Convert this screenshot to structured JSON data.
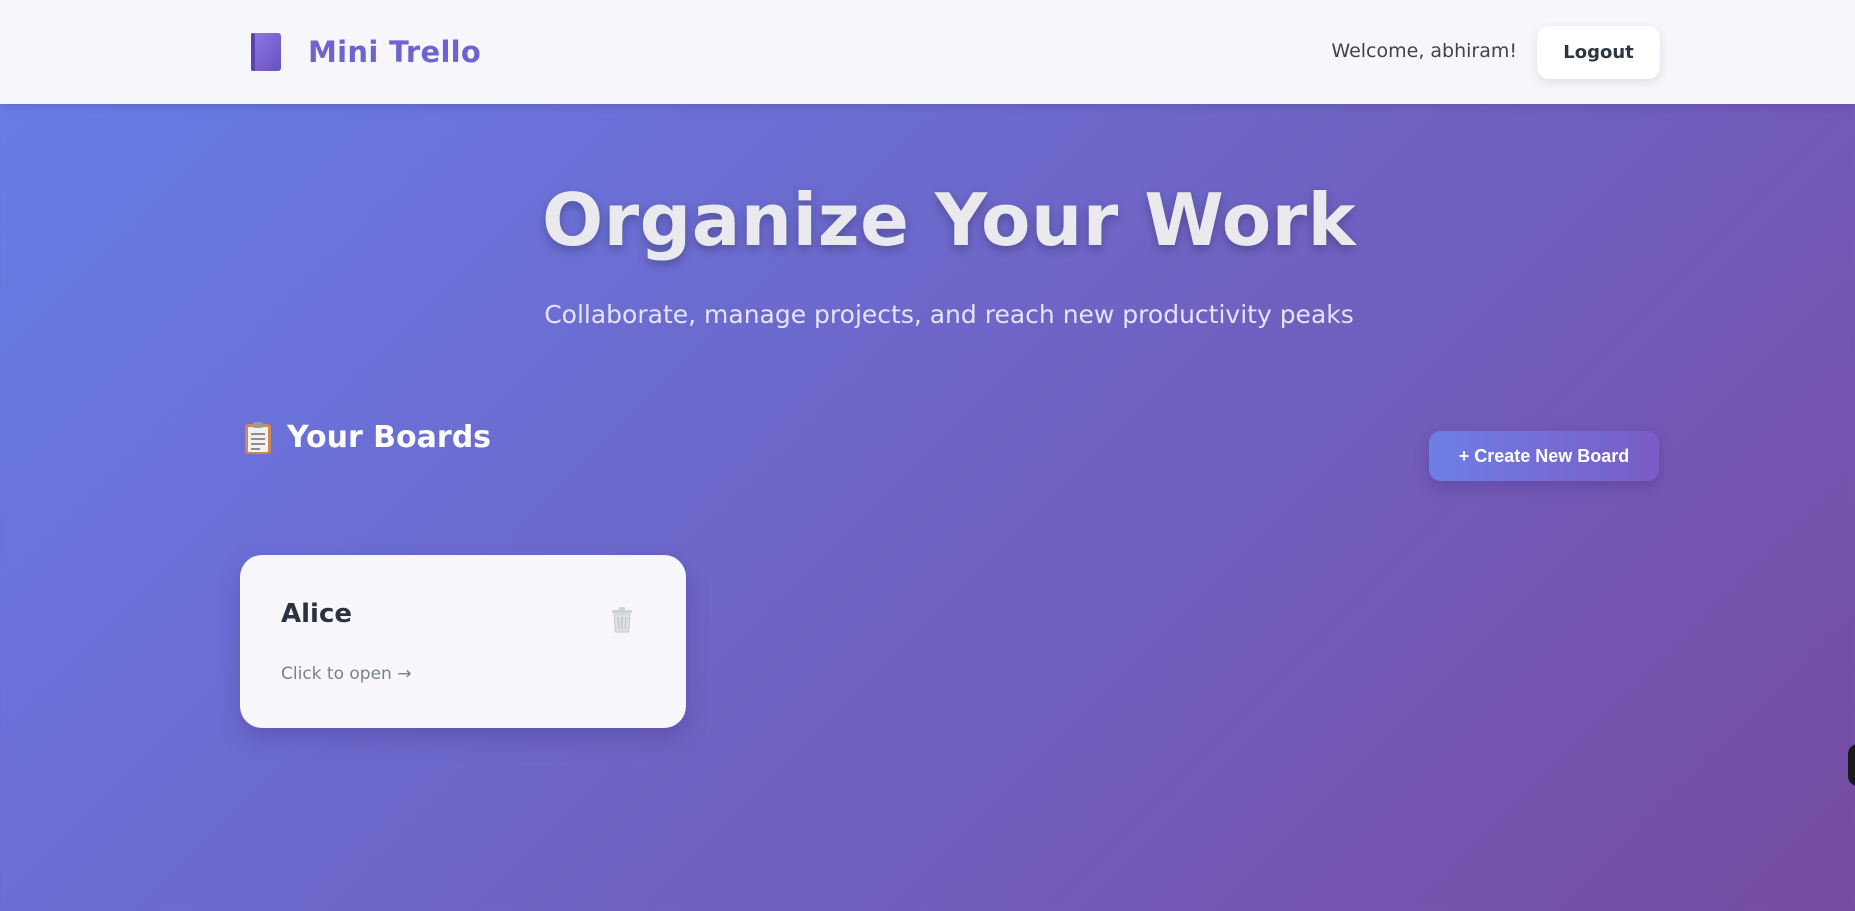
{
  "header": {
    "app_title": "Mini Trello",
    "welcome_text": "Welcome, abhiram!",
    "logout_label": "Logout"
  },
  "hero": {
    "title": "Organize Your Work",
    "subtitle": "Collaborate, manage projects, and reach new productivity peaks"
  },
  "boards_section": {
    "title": "Your Boards",
    "create_label": "+ Create New Board",
    "boards": [
      {
        "name": "Alice",
        "hint": "Click to open →"
      }
    ]
  },
  "colors": {
    "gradient_start": "#667eea",
    "gradient_end": "#764ba2",
    "brand": "#6d63d1",
    "card_bg": "#f6f6fb"
  },
  "icons": {
    "brand": "notebook-icon",
    "section": "clipboard-icon",
    "delete": "trash-icon"
  }
}
